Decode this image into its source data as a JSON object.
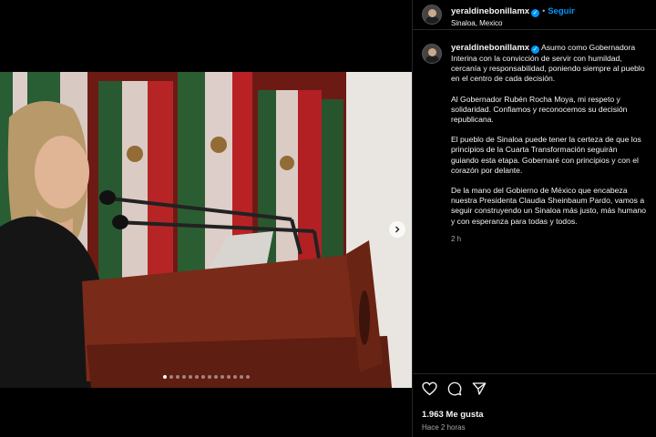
{
  "post": {
    "username": "yeraldinebonillamx",
    "follow_label": "Seguir",
    "separator": "•",
    "location": "Sinaloa, Mexico"
  },
  "caption": {
    "paragraphs": [
      "Asumo como Gobernadora Interina con la convicción de servir con humildad, cercanía y responsabilidad, poniendo siempre al pueblo en el centro de cada decisión.",
      "Al Gobernador Rubén Rocha Moya, mi respeto y solidaridad. Confiamos y reconocemos su decisión republicana.",
      "El pueblo de Sinaloa puede tener la certeza de que los principios de la Cuarta Transformación seguirán guiando esta etapa. Gobernaré con principios y con el corazón por delante.",
      "De la mano del Gobierno de México que encabeza nuestra Presidenta Claudia Sheinbaum Pardo, vamos a seguir construyendo un Sinaloa más justo, más humano y con esperanza para todas y todos."
    ],
    "time_ago": "2 h"
  },
  "stats": {
    "likes": "1.963 Me gusta",
    "posted": "Hace 2 horas"
  },
  "carousel": {
    "count": 14,
    "active_index": 0
  },
  "icons": {
    "like": "heart-icon",
    "comment": "comment-icon",
    "share": "share-icon",
    "next": "chevron-right-icon",
    "verified": "verified-badge-icon"
  },
  "colors": {
    "accent": "#0095f6",
    "background": "#000000",
    "text": "#f5f5f5",
    "muted": "#a8a8a8"
  }
}
